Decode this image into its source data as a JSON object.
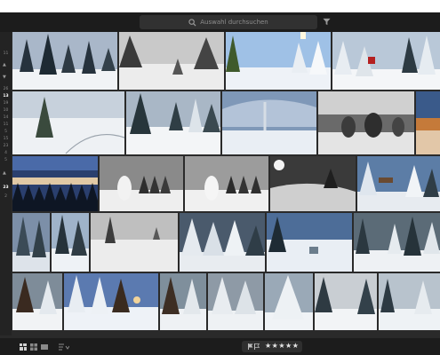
{
  "search": {
    "placeholder": "Auswahl durchsuchen"
  },
  "sidebar": {
    "labels": [
      "11",
      "26",
      "13",
      "19",
      "10",
      "14",
      "11",
      "5",
      "15",
      "23",
      "4",
      "5",
      "2"
    ],
    "active_label": "13",
    "bottom_label": "23",
    "markers": [
      "▲",
      "▼",
      "▲",
      "▼"
    ]
  },
  "bottom": {
    "rating": "★★★★★",
    "rating_value": 5
  },
  "colors": {
    "chrome_bg": "#1c1c1c",
    "grid_bg": "#2a2a2a",
    "accent_star": "#e6e6e6"
  }
}
